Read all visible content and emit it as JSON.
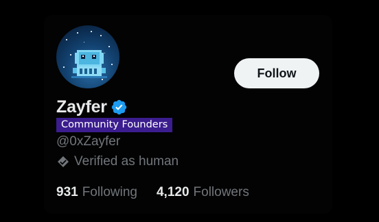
{
  "profile": {
    "avatar_icon": "pixel-robot-icon",
    "display_name": "Zayfer",
    "verified_icon": "verified-badge-icon",
    "verified_color": "#1d9bf0",
    "community_badge": "Community Founders",
    "community_badge_color": "#3b1d8f",
    "handle": "@0xZayfer",
    "verified_human_icon": "human-shield-icon",
    "verified_human_label": "Verified as human"
  },
  "actions": {
    "follow_label": "Follow"
  },
  "stats": {
    "following_count": "931",
    "following_label": "Following",
    "followers_count": "4,120",
    "followers_label": "Followers"
  }
}
